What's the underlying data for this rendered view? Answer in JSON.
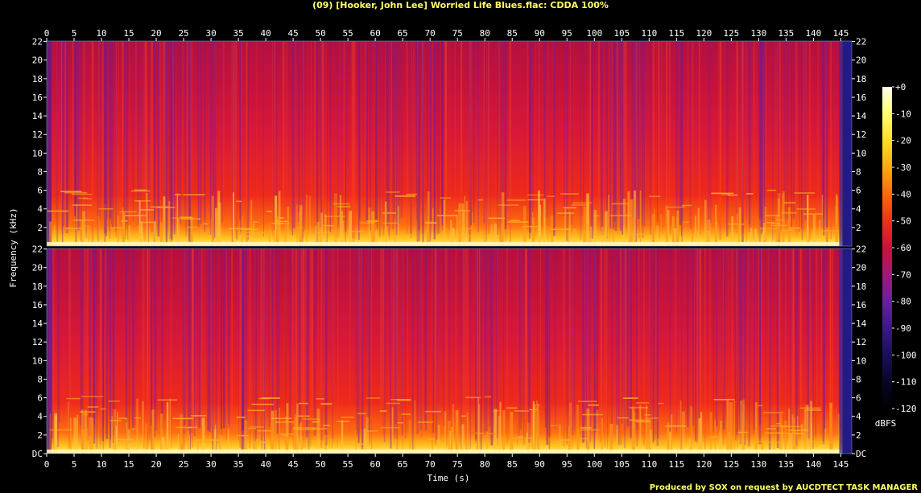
{
  "title": "(09) [Hooker, John Lee] Worried Life Blues.flac: CDDA 100%",
  "credit": "Produced by SOX on request by AUCDTECT TASK MANAGER",
  "chart_data": {
    "type": "heatmap",
    "title": "(09) [Hooker, John Lee] Worried Life Blues.flac: CDDA 100%",
    "xlabel": "Time (s)",
    "ylabel": "Frequency (kHz)",
    "xlim": [
      0,
      147
    ],
    "ylim": [
      0,
      22.05
    ],
    "x_ticks": [
      0,
      5,
      10,
      15,
      20,
      25,
      30,
      35,
      40,
      45,
      50,
      55,
      60,
      65,
      70,
      75,
      80,
      85,
      90,
      95,
      100,
      105,
      110,
      115,
      120,
      125,
      130,
      135,
      140,
      145
    ],
    "y_tick_labels": [
      "DC",
      "2",
      "4",
      "6",
      "8",
      "10",
      "12",
      "14",
      "16",
      "18",
      "20",
      "22"
    ],
    "channels": 2,
    "colorbar": {
      "unit": "dBFS",
      "range": [
        -120,
        0
      ],
      "tick_labels": [
        "+0",
        "-10",
        "-20",
        "-30",
        "-40",
        "-50",
        "-60",
        "-70",
        "-80",
        "-90",
        "-100",
        "-110",
        "-120"
      ],
      "colors": {
        "0": "#ffffe8",
        "-10": "#ffff70",
        "-20": "#ffdd20",
        "-30": "#ffaa10",
        "-40": "#ff6a08",
        "-50": "#f03018",
        "-60": "#d0103a",
        "-70": "#a01878",
        "-80": "#6a20a0",
        "-90": "#3a1888",
        "-100": "#18105a",
        "-110": "#080628",
        "-120": "#000000"
      }
    }
  }
}
